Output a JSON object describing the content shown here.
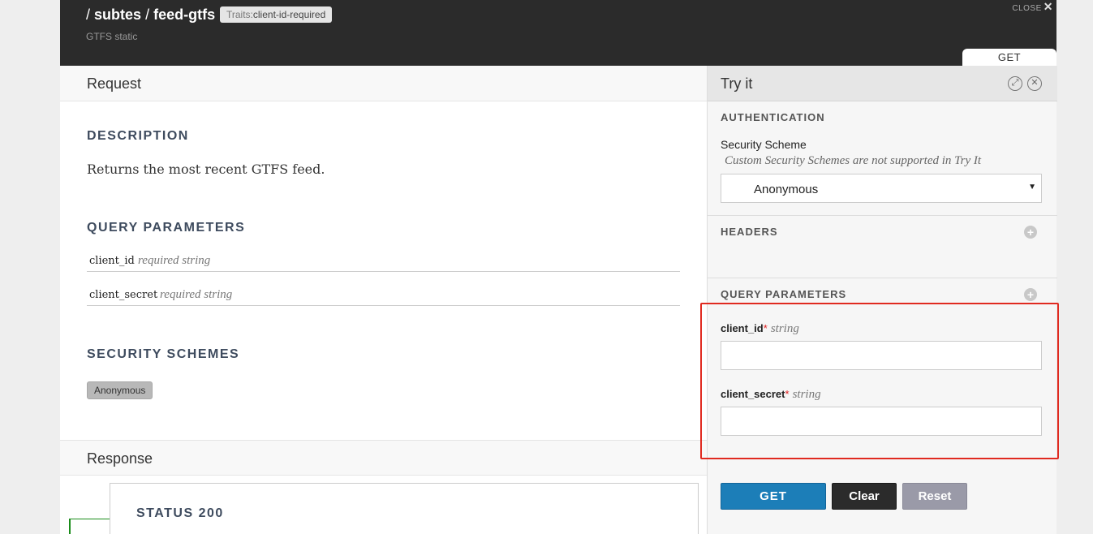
{
  "header": {
    "slash1": "/",
    "res1": "subtes",
    "slash2": "/",
    "res2": "feed-gtfs",
    "traits_key": "Traits:",
    "traits_value": "client-id-required",
    "subtitle": "GTFS static",
    "close_label": "CLOSE",
    "close_icon": "✕",
    "method": "GET"
  },
  "request": {
    "title": "Request",
    "description_heading": "DESCRIPTION",
    "description": "Returns the most recent GTFS feed.",
    "query_heading": "QUERY PARAMETERS",
    "params": [
      {
        "name": "client_id",
        "type": "required string"
      },
      {
        "name": "client_secret",
        "type": "required string"
      }
    ],
    "security_heading": "SECURITY SCHEMES",
    "security_badge": "Anonymous"
  },
  "response": {
    "title": "Response",
    "status": "STATUS 200"
  },
  "try_it": {
    "title": "Try it",
    "expand_icon": "⤢",
    "close_icon": "✕",
    "auth_heading": "AUTHENTICATION",
    "security_scheme_label": "Security Scheme",
    "security_note": "Custom Security Schemes are not supported in Try It",
    "security_select_value": "Anonymous",
    "select_arrow": "▼",
    "headers_heading": "HEADERS",
    "query_heading": "QUERY PARAMETERS",
    "add_icon": "+",
    "query_params": [
      {
        "name": "client_id",
        "required_mark": "*",
        "type": "string",
        "value": ""
      },
      {
        "name": "client_secret",
        "required_mark": "*",
        "type": "string",
        "value": ""
      }
    ],
    "buttons": {
      "get": "GET",
      "clear": "Clear",
      "reset": "Reset"
    }
  },
  "colors": {
    "header_bg": "#2b2b2b",
    "get_button": "#1c7eb8",
    "clear_button": "#2b2b2b",
    "reset_button": "#9a9aa8",
    "highlight": "#e02a20",
    "required": "#e02020"
  }
}
